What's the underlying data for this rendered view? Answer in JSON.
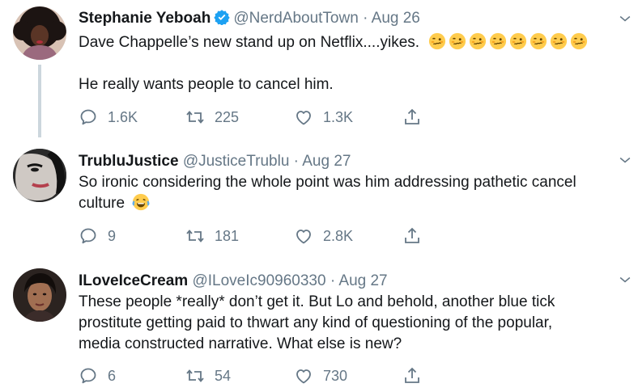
{
  "tweets": [
    {
      "name": "Stephanie Yeboah",
      "handle": "@NerdAboutTown",
      "separator": "·",
      "date": "Aug 26",
      "verified": true,
      "text_line1": "Dave Chappelle’s new stand up on Netflix....yikes.",
      "text_line2": "He really wants people to cancel him.",
      "emoji_icon": "woozy-face-icon",
      "emoji_count": 8,
      "replies": "1.6K",
      "retweets": "225",
      "likes": "1.3K"
    },
    {
      "name": "TrubluJustice",
      "handle": "@JusticeTrublu",
      "separator": "·",
      "date": "Aug 27",
      "verified": false,
      "text_line1": "So ironic considering the whole point was him addressing pathetic cancel",
      "text_line2": "culture",
      "emoji_icon": "tears-of-joy-icon",
      "replies": "9",
      "retweets": "181",
      "likes": "2.8K"
    },
    {
      "name": "ILoveIceCream",
      "handle": "@ILoveIc90960330",
      "separator": "·",
      "date": "Aug 27",
      "verified": false,
      "text_line1": "These people *really* don’t get it. But Lo and behold, another blue tick",
      "text_line2": "prostitute getting paid to thwart any kind of questioning of the popular,",
      "text_line3": "media constructed narrative. What else is new?",
      "replies": "6",
      "retweets": "54",
      "likes": "730"
    }
  ],
  "colors": {
    "text": "#14171a",
    "muted": "#657786",
    "verified": "#1da1f2",
    "thread_line": "#ccd6dd"
  }
}
